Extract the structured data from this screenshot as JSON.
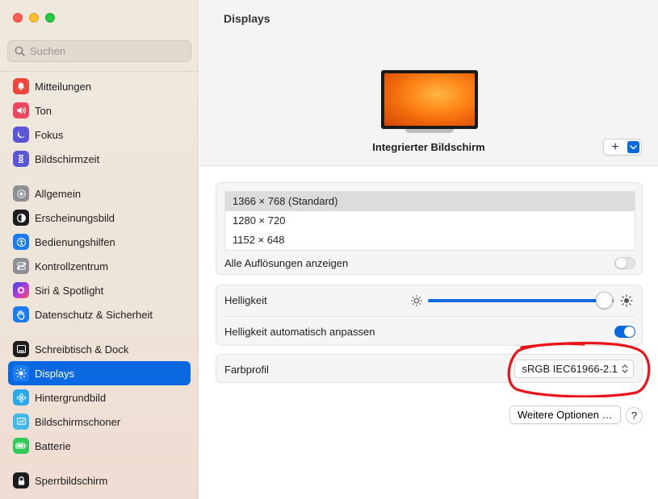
{
  "window": {
    "title": "Displays"
  },
  "search": {
    "placeholder": "Suchen",
    "value": ""
  },
  "sidebar": {
    "items": [
      {
        "label": "Mitteilungen",
        "icon": "bell-icon",
        "color": "#f0453a",
        "active": false
      },
      {
        "label": "Ton",
        "icon": "speaker-icon",
        "color": "#f0455f",
        "active": false
      },
      {
        "label": "Fokus",
        "icon": "moon-icon",
        "color": "#5a56d6",
        "active": false
      },
      {
        "label": "Bildschirmzeit",
        "icon": "hourglass-icon",
        "color": "#5a56d6",
        "active": false
      },
      {
        "label": "Allgemein",
        "icon": "gear-icon",
        "color": "#8e8e93",
        "active": false
      },
      {
        "label": "Erscheinungsbild",
        "icon": "appearance-icon",
        "color": "#1c1c1e",
        "active": false
      },
      {
        "label": "Bedienungshilfen",
        "icon": "accessibility-icon",
        "color": "#1a7cf0",
        "active": false
      },
      {
        "label": "Kontrollzentrum",
        "icon": "toggles-icon",
        "color": "#8e8e93",
        "active": false
      },
      {
        "label": "Siri & Spotlight",
        "icon": "siri-icon",
        "color": "#b13cd1",
        "active": false
      },
      {
        "label": "Datenschutz & Sicherheit",
        "icon": "hand-icon",
        "color": "#1a7cf0",
        "active": false
      },
      {
        "label": "Schreibtisch & Dock",
        "icon": "dock-icon",
        "color": "#1c1c1e",
        "active": false
      },
      {
        "label": "Displays",
        "icon": "sun-icon",
        "color": "#1a7cf0",
        "active": true
      },
      {
        "label": "Hintergrundbild",
        "icon": "flower-icon",
        "color": "#2aa7e8",
        "active": false
      },
      {
        "label": "Bildschirmschoner",
        "icon": "screensaver-icon",
        "color": "#43b7e8",
        "active": false
      },
      {
        "label": "Batterie",
        "icon": "battery-icon",
        "color": "#34c759",
        "active": false
      },
      {
        "label": "Sperrbildschirm",
        "icon": "lock-icon",
        "color": "#1c1c1e",
        "active": false
      }
    ]
  },
  "main": {
    "display_name": "Integrierter Bildschirm",
    "add_button": "+",
    "resolutions": [
      {
        "label": "1366 × 768 (Standard)",
        "selected": true
      },
      {
        "label": "1280 × 720",
        "selected": false
      },
      {
        "label": "1152 × 648",
        "selected": false
      }
    ],
    "all_resolutions_label": "Alle Auflösungen anzeigen",
    "all_resolutions_on": false,
    "brightness_label": "Helligkeit",
    "brightness_level": 1.0,
    "auto_brightness_label": "Helligkeit automatisch anpassen",
    "auto_brightness_on": true,
    "color_profile_label": "Farbprofil",
    "color_profile_value": "sRGB IEC61966-2.1",
    "more_options_button": "Weitere Optionen …",
    "help_button": "?"
  },
  "colors": {
    "accent": "#0a69e0",
    "annotation": "#e8141a"
  }
}
